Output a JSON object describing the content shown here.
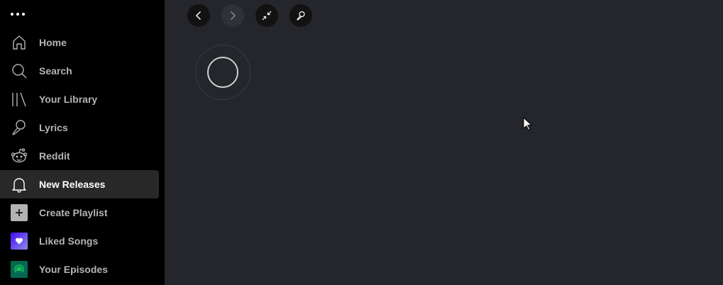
{
  "sidebar": {
    "items": [
      {
        "label": "Home",
        "icon": "home-icon"
      },
      {
        "label": "Search",
        "icon": "search-icon"
      },
      {
        "label": "Your Library",
        "icon": "library-icon"
      },
      {
        "label": "Lyrics",
        "icon": "microphone-icon"
      },
      {
        "label": "Reddit",
        "icon": "reddit-icon"
      },
      {
        "label": "New Releases",
        "icon": "bell-icon",
        "active": true
      },
      {
        "label": "Create Playlist",
        "icon": "plus-icon"
      },
      {
        "label": "Liked Songs",
        "icon": "heart-icon"
      },
      {
        "label": "Your Episodes",
        "icon": "podcast-icon"
      }
    ]
  },
  "topbar": {
    "buttons": [
      "back-icon",
      "forward-icon",
      "collapse-icon",
      "microphone-icon"
    ]
  },
  "colors": {
    "sidebar_bg": "#000000",
    "main_bg": "#24262b",
    "active_item_bg": "#282828",
    "liked_songs_gradient": [
      "#450af5",
      "#8e8ee5"
    ],
    "episodes_tile": "#056952"
  }
}
